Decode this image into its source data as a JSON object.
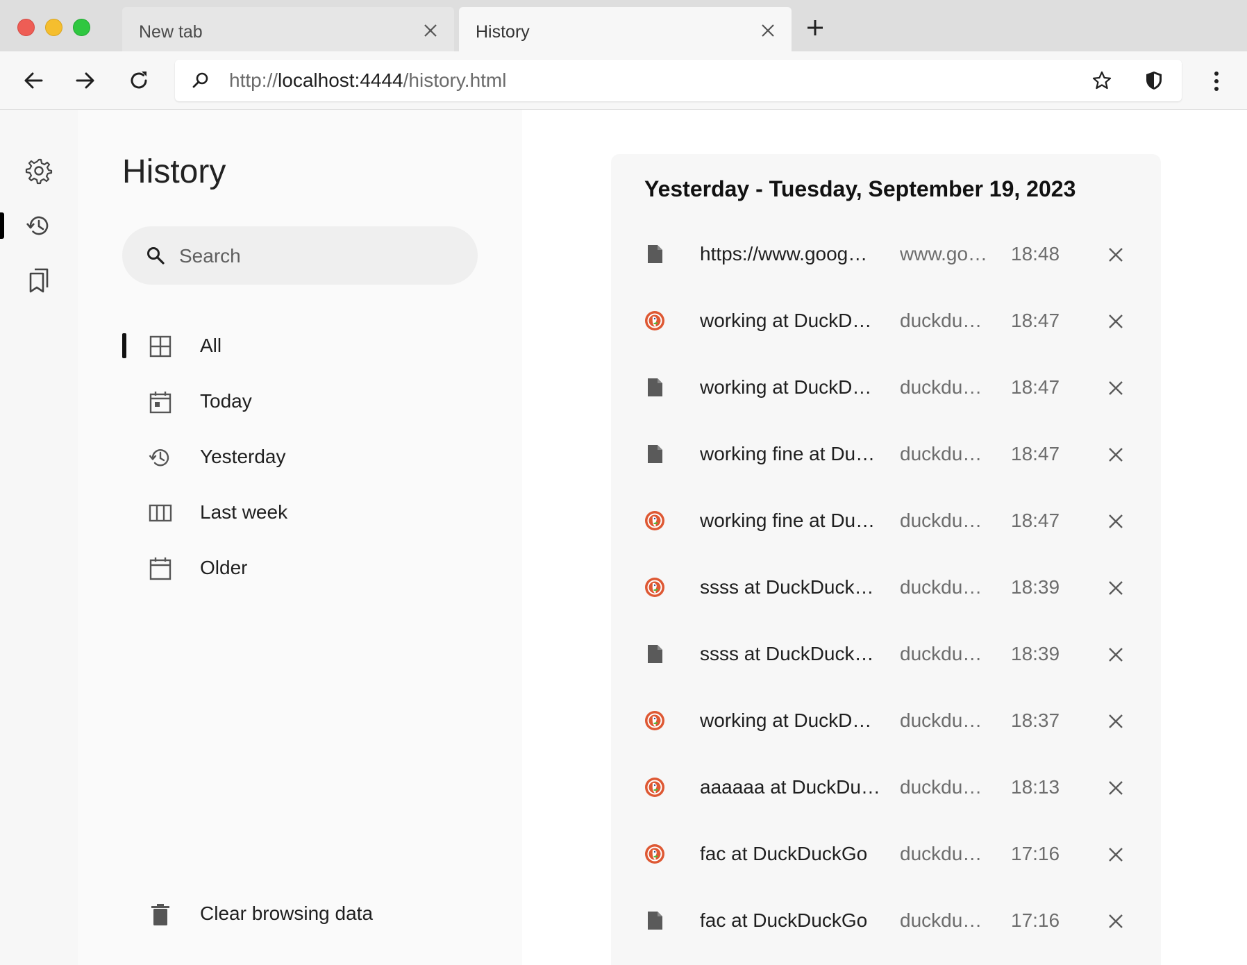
{
  "window": {
    "tabs": [
      {
        "title": "New tab",
        "active": false
      },
      {
        "title": "History",
        "active": true
      }
    ]
  },
  "toolbar": {
    "url_scheme": "http://",
    "url_host": "localhost:4444",
    "url_path": "/history.html"
  },
  "rail": {
    "items": [
      "settings",
      "history",
      "bookmarks"
    ],
    "active": "history"
  },
  "sidebar": {
    "title": "History",
    "search_placeholder": "Search",
    "nav": [
      {
        "label": "All",
        "icon": "grid-icon",
        "active": true
      },
      {
        "label": "Today",
        "icon": "calendar-today-icon",
        "active": false
      },
      {
        "label": "Yesterday",
        "icon": "history-icon",
        "active": false
      },
      {
        "label": "Last week",
        "icon": "week-columns-icon",
        "active": false
      },
      {
        "label": "Older",
        "icon": "calendar-icon",
        "active": false
      }
    ],
    "clear_label": "Clear browsing data"
  },
  "main": {
    "heading": "Yesterday - Tuesday, September 19, 2023",
    "entries": [
      {
        "title": "https://www.goog…",
        "domain": "www.go…",
        "time": "18:48",
        "icon": "page-icon"
      },
      {
        "title": "working at DuckD…",
        "domain": "duckdu…",
        "time": "18:47",
        "icon": "duckduckgo-icon"
      },
      {
        "title": "working at DuckD…",
        "domain": "duckdu…",
        "time": "18:47",
        "icon": "page-icon"
      },
      {
        "title": "working fine at Du…",
        "domain": "duckdu…",
        "time": "18:47",
        "icon": "page-icon"
      },
      {
        "title": "working fine at Du…",
        "domain": "duckdu…",
        "time": "18:47",
        "icon": "duckduckgo-icon"
      },
      {
        "title": "ssss at DuckDuck…",
        "domain": "duckdu…",
        "time": "18:39",
        "icon": "duckduckgo-icon"
      },
      {
        "title": "ssss at DuckDuck…",
        "domain": "duckdu…",
        "time": "18:39",
        "icon": "page-icon"
      },
      {
        "title": "working at DuckD…",
        "domain": "duckdu…",
        "time": "18:37",
        "icon": "duckduckgo-icon"
      },
      {
        "title": "aaaaaa at DuckDu…",
        "domain": "duckdu…",
        "time": "18:13",
        "icon": "duckduckgo-icon"
      },
      {
        "title": "fac at DuckDuckGo",
        "domain": "duckdu…",
        "time": "17:16",
        "icon": "duckduckgo-icon"
      },
      {
        "title": "fac at DuckDuckGo",
        "domain": "duckdu…",
        "time": "17:16",
        "icon": "page-icon"
      }
    ]
  },
  "colors": {
    "titlebar": "#dedede",
    "toolbar": "#f7f7f7",
    "card": "#f7f7f7",
    "sidepanel": "#fafafa",
    "ddg_orange": "#de5833"
  }
}
